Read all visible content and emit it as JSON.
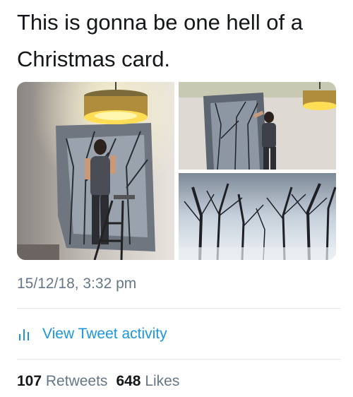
{
  "tweet": {
    "text": "This is gonna be one hell of a Christmas card.",
    "timestamp": "15/12/18, 3:32 pm",
    "activity_label": "View Tweet activity",
    "retweets_count": "107",
    "retweets_label": "Retweets",
    "likes_count": "648",
    "likes_label": "Likes"
  },
  "colors": {
    "text": "#14171a",
    "secondary": "#657786",
    "link": "#1b95e0",
    "divider": "#e1e8ed"
  },
  "icons": {
    "activity": "bar-chart-icon"
  }
}
